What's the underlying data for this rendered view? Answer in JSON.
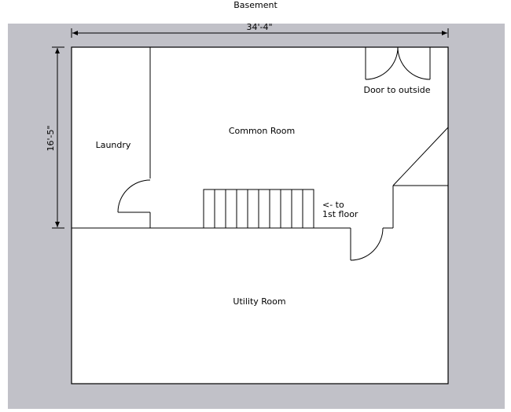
{
  "title": "Basement",
  "dimensions": {
    "width_label": "34'-4\"",
    "height_label": "16'-5\""
  },
  "rooms": {
    "common": "Common Room",
    "laundry": "Laundry",
    "utility": "Utility Room"
  },
  "labels": {
    "door_outside": "Door to outside",
    "stairs_line1": "<- to",
    "stairs_line2": "1st floor"
  },
  "stair_treads": 10,
  "colors": {
    "background_panel": "#c1c1c8",
    "floor": "#ffffff",
    "line": "#000000"
  }
}
